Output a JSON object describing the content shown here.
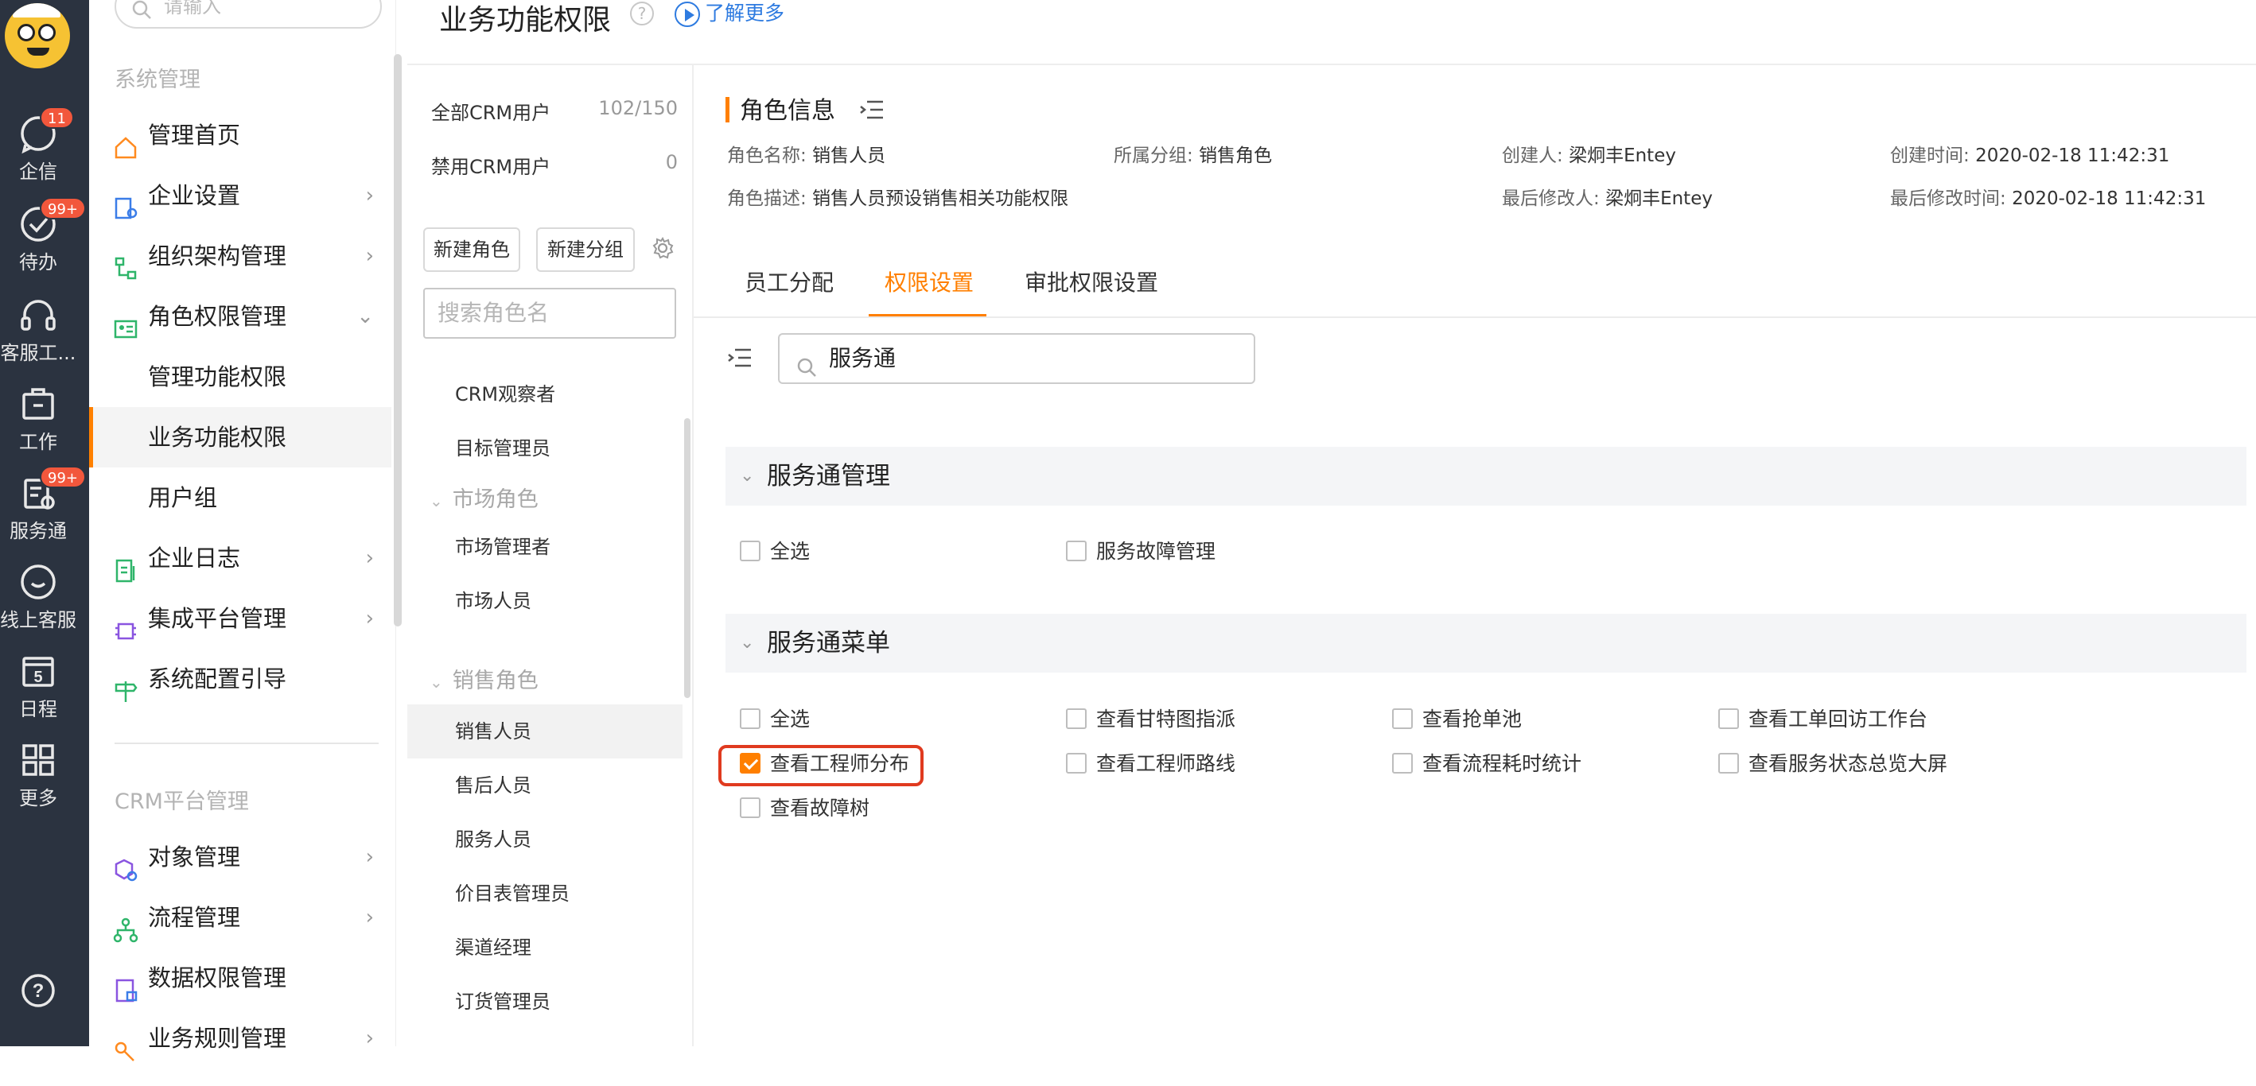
{
  "rail": {
    "items": [
      {
        "label": "企信",
        "badge": "11"
      },
      {
        "label": "待办",
        "badge": "99+"
      },
      {
        "label": "客服工..."
      },
      {
        "label": "工作"
      },
      {
        "label": "服务通",
        "badge": "99+"
      },
      {
        "label": "线上客服"
      },
      {
        "label": "日程",
        "day": "5"
      },
      {
        "label": "更多"
      }
    ],
    "help_icon": "?"
  },
  "nav": {
    "search_placeholder": "请输入",
    "section_system": "系统管理",
    "items": [
      {
        "label": "管理首页"
      },
      {
        "label": "企业设置"
      },
      {
        "label": "组织架构管理"
      },
      {
        "label": "角色权限管理"
      },
      {
        "label": "管理功能权限"
      },
      {
        "label": "业务功能权限"
      },
      {
        "label": "用户组"
      },
      {
        "label": "企业日志"
      },
      {
        "label": "集成平台管理"
      },
      {
        "label": "系统配置引导"
      }
    ],
    "section_crm": "CRM平台管理",
    "crm_items": [
      {
        "label": "对象管理"
      },
      {
        "label": "流程管理"
      },
      {
        "label": "数据权限管理"
      },
      {
        "label": "业务规则管理"
      }
    ]
  },
  "header": {
    "title": "业务功能权限",
    "help": "?",
    "learn_more": "了解更多"
  },
  "roles": {
    "all_users_label": "全部CRM用户",
    "all_users_count": "102/150",
    "disabled_users_label": "禁用CRM用户",
    "disabled_users_count": "0",
    "new_role": "新建角色",
    "new_group": "新建分组",
    "search_placeholder": "搜索角色名",
    "list": [
      {
        "type": "item",
        "label": "CRM观察者"
      },
      {
        "type": "item",
        "label": "目标管理员"
      },
      {
        "type": "group",
        "label": "市场角色"
      },
      {
        "type": "item",
        "label": "市场管理者"
      },
      {
        "type": "item",
        "label": "市场人员"
      },
      {
        "type": "group",
        "label": "销售角色"
      },
      {
        "type": "item",
        "label": "销售人员",
        "selected": true
      },
      {
        "type": "item",
        "label": "售后人员"
      },
      {
        "type": "item",
        "label": "服务人员"
      },
      {
        "type": "item",
        "label": "价目表管理员"
      },
      {
        "type": "item",
        "label": "渠道经理"
      },
      {
        "type": "item",
        "label": "订货管理员"
      }
    ]
  },
  "role_info": {
    "title": "角色信息",
    "name_label": "角色名称:",
    "name_value": "销售人员",
    "group_label": "所属分组:",
    "group_value": "销售角色",
    "creator_label": "创建人:",
    "creator_value": "梁炯丰Entey",
    "created_label": "创建时间:",
    "created_value": "2020-02-18 11:42:31",
    "desc_label": "角色描述:",
    "desc_value": "销售人员预设销售相关功能权限",
    "modifier_label": "最后修改人:",
    "modifier_value": "梁炯丰Entey",
    "modified_label": "最后修改时间:",
    "modified_value": "2020-02-18 11:42:31"
  },
  "tabs": [
    {
      "label": "员工分配"
    },
    {
      "label": "权限设置",
      "active": true
    },
    {
      "label": "审批权限设置"
    }
  ],
  "perm_search": {
    "value": "服务通"
  },
  "sections": [
    {
      "title": "服务通管理",
      "items": [
        {
          "label": "全选",
          "checked": false
        },
        {
          "label": "服务故障管理",
          "checked": false
        }
      ]
    },
    {
      "title": "服务通菜单",
      "items": [
        {
          "label": "全选",
          "checked": false
        },
        {
          "label": "查看甘特图指派",
          "checked": false
        },
        {
          "label": "查看抢单池",
          "checked": false
        },
        {
          "label": "查看工单回访工作台",
          "checked": false
        },
        {
          "label": "查看工程师分布",
          "checked": true
        },
        {
          "label": "查看工程师路线",
          "checked": false
        },
        {
          "label": "查看流程耗时统计",
          "checked": false
        },
        {
          "label": "查看服务状态总览大屏",
          "checked": false
        },
        {
          "label": "查看故障树",
          "checked": false
        }
      ]
    }
  ],
  "colors": {
    "accent": "#ff7f00",
    "rail_bg": "#2b3340",
    "highlight": "#e03a1f",
    "badge": "#f2573c"
  }
}
